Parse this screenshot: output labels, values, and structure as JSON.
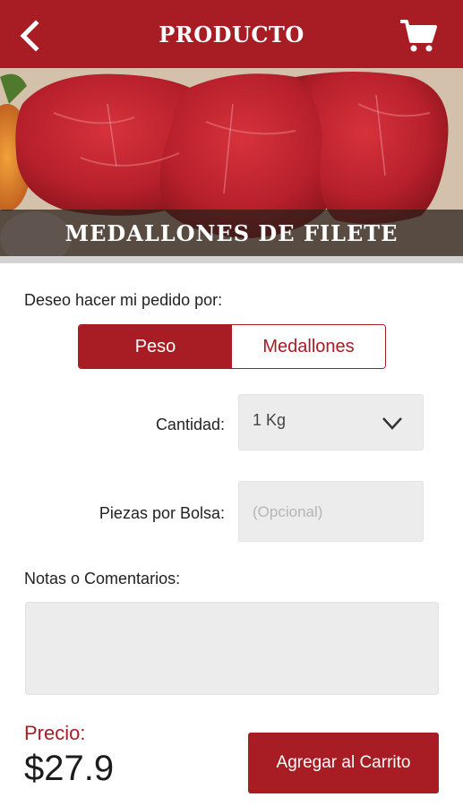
{
  "header": {
    "title": "PRODUCTO",
    "back_icon": "chevron-left-icon",
    "cart_icon": "shopping-cart-icon"
  },
  "product": {
    "name": "MEDALLONES DE FILETE"
  },
  "order": {
    "prompt": "Deseo hacer mi pedido por:",
    "options": [
      "Peso",
      "Medallones"
    ],
    "selected": "Peso"
  },
  "cantidad": {
    "label": "Cantidad:",
    "value": "1 Kg"
  },
  "piezas": {
    "label": "Piezas por Bolsa:",
    "placeholder": "(Opcional)"
  },
  "notas": {
    "label": "Notas o Comentarios:"
  },
  "price": {
    "label": "Precio:",
    "value": "$27.9"
  },
  "cta": {
    "label": "Agregar al Carrito"
  },
  "colors": {
    "brand": "#a81c24",
    "field_bg": "#ececec"
  }
}
